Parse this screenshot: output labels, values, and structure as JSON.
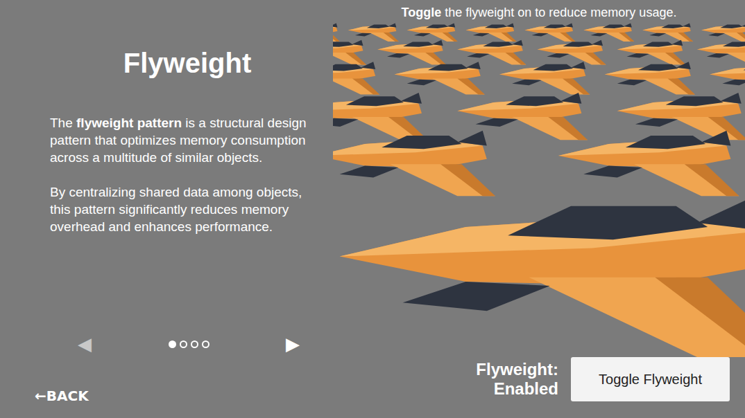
{
  "title": "Flyweight",
  "paragraphs": [
    [
      {
        "text": "The ",
        "bold": false
      },
      {
        "text": "flyweight pattern",
        "bold": true
      },
      {
        "text": " is a structural design pattern that optimizes memory consumption across a multitude of similar objects.",
        "bold": false
      }
    ],
    [
      {
        "text": "By centralizing shared data among objects, this pattern significantly reduces memory overhead and enhances performance.",
        "bold": false
      }
    ]
  ],
  "pager": {
    "prev": "◀",
    "next": "▶",
    "dots": [
      {
        "selected": true
      },
      {
        "selected": false
      },
      {
        "selected": false
      },
      {
        "selected": false
      }
    ]
  },
  "back": "←BACK",
  "hint": [
    {
      "text": "Toggle",
      "bold": true
    },
    {
      "text": " the flyweight on to reduce memory usage.",
      "bold": false
    }
  ],
  "status": {
    "label": "Flyweight:",
    "value": "Enabled",
    "enabled": true
  },
  "button": "Toggle Flyweight"
}
